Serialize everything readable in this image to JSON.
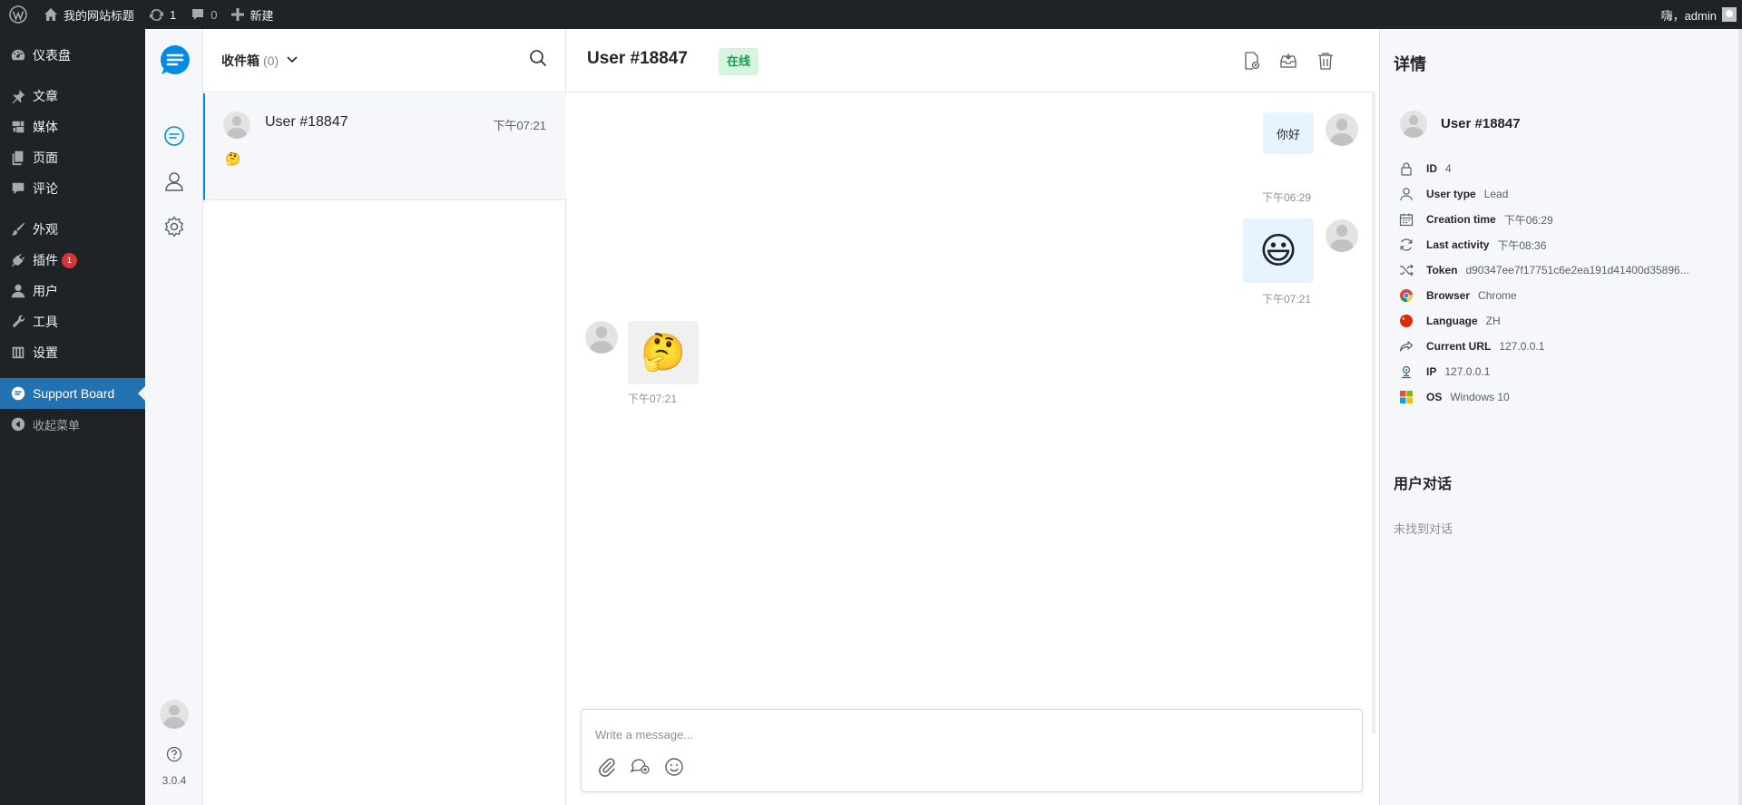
{
  "adminbar": {
    "site_title": "我的网站标题",
    "updates_count": "1",
    "comments_count": "0",
    "new_label": "新建",
    "greeting": "嗨，admin"
  },
  "menu": {
    "dashboard": "仪表盘",
    "posts": "文章",
    "media": "媒体",
    "pages": "页面",
    "comments": "评论",
    "appearance": "外观",
    "plugins": "插件",
    "plugins_badge": "1",
    "users": "用户",
    "tools": "工具",
    "settings": "设置",
    "support_board": "Support Board",
    "collapse": "收起菜单"
  },
  "nav": {
    "version": "3.0.4"
  },
  "list": {
    "inbox_label": "收件箱",
    "inbox_count": "(0)",
    "conversations": [
      {
        "name": "User #18847",
        "time": "下午07:21",
        "preview": "🤔"
      }
    ]
  },
  "chat": {
    "title": "User #18847",
    "status": "在线",
    "messages": [
      {
        "side": "right",
        "text": "你好",
        "time": "下午06:29"
      },
      {
        "side": "right",
        "text": "😃",
        "time": "下午07:21"
      },
      {
        "side": "left",
        "text": "🤔",
        "time": "下午07:21"
      }
    ],
    "composer_placeholder": "Write a message..."
  },
  "details": {
    "title": "详情",
    "username": "User #18847",
    "rows": [
      {
        "icon": "lock-icon",
        "label": "ID",
        "value": "4"
      },
      {
        "icon": "user-icon",
        "label": "User type",
        "value": "Lead"
      },
      {
        "icon": "calendar-icon",
        "label": "Creation time",
        "value": "下午06:29"
      },
      {
        "icon": "refresh-icon",
        "label": "Last activity",
        "value": "下午08:36"
      },
      {
        "icon": "shuffle-icon",
        "label": "Token",
        "value": "d90347ee7f17751c6e2ea191d41400d35896..."
      },
      {
        "icon": "chrome-icon",
        "label": "Browser",
        "value": "Chrome"
      },
      {
        "icon": "flag-icon",
        "label": "Language",
        "value": "ZH"
      },
      {
        "icon": "share-icon",
        "label": "Current URL",
        "value": "127.0.0.1"
      },
      {
        "icon": "location-icon",
        "label": "IP",
        "value": "127.0.0.1"
      },
      {
        "icon": "windows-icon",
        "label": "OS",
        "value": "Windows 10"
      }
    ],
    "conversations_title": "用户对话",
    "no_conversations": "未找到对话"
  },
  "colors": {
    "wp_dark": "#1d2327",
    "wp_blue": "#2271b1",
    "sb_accent": "#028be5",
    "online_bg": "#d6f5e1",
    "online_text": "#1a9a4e",
    "bubble_right": "#e7f3fe"
  }
}
